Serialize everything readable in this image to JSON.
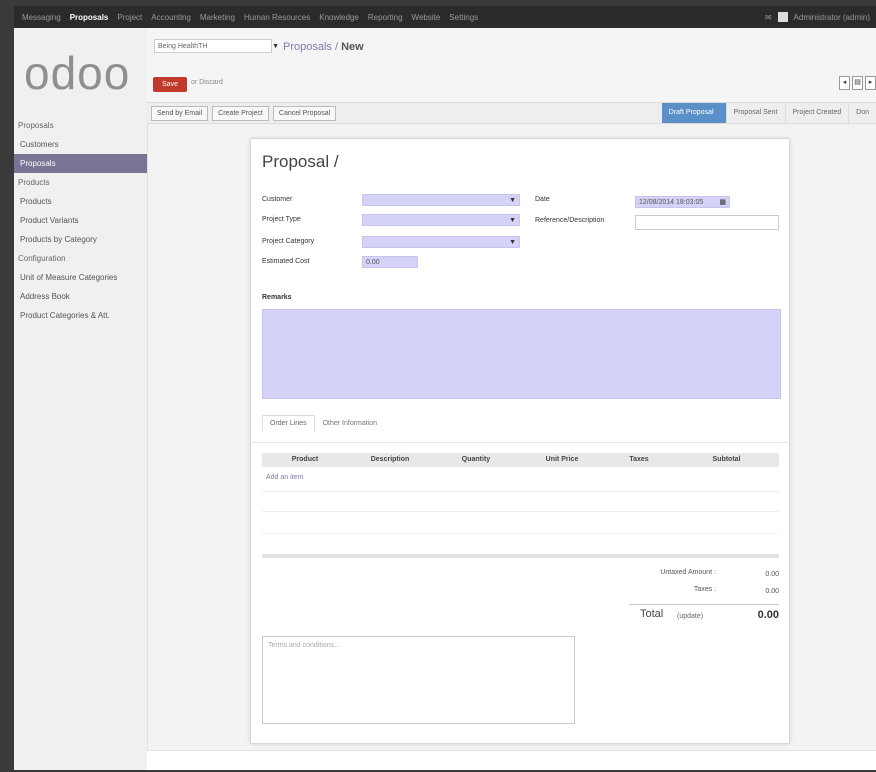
{
  "topbar": {
    "menu": [
      "Messaging",
      "Proposals",
      "Project",
      "Accounting",
      "Marketing",
      "Human Resources",
      "Knowledge",
      "Reporting",
      "Website",
      "Settings"
    ],
    "active_index": 1,
    "user": "Administrator (admin)"
  },
  "sidebar": {
    "logo": "odoo",
    "items": [
      {
        "label": "Proposals",
        "kind": "hdr"
      },
      {
        "label": "Customers",
        "kind": "sub"
      },
      {
        "label": "Proposals",
        "kind": "sub",
        "active": true
      },
      {
        "label": "Products",
        "kind": "hdr"
      },
      {
        "label": "Products",
        "kind": "sub"
      },
      {
        "label": "Product Variants",
        "kind": "sub"
      },
      {
        "label": "Products by Category",
        "kind": "sub"
      },
      {
        "label": "Configuration",
        "kind": "hdr"
      },
      {
        "label": "Unit of Measure Categories",
        "kind": "sub"
      },
      {
        "label": "Address Book",
        "kind": "sub"
      },
      {
        "label": "Product Categories & Att.",
        "kind": "sub"
      }
    ]
  },
  "header": {
    "db": "Being HealthTH",
    "breadcrumb_parent": "Proposals",
    "breadcrumb_sep": " / ",
    "breadcrumb_current": "New",
    "save_label": "Save",
    "discard_label": "or Discard"
  },
  "actions": {
    "buttons": [
      "Send by Email",
      "Create Project",
      "Cancel Proposal"
    ]
  },
  "status": {
    "steps": [
      "Draft Proposal",
      "Proposal Sent",
      "Project Created",
      "Don"
    ],
    "current_index": 0
  },
  "form": {
    "title": "Proposal /",
    "customer_label": "Customer",
    "project_type_label": "Project Type",
    "project_category_label": "Project Category",
    "estimated_cost_label": "Estimated Cost",
    "estimated_cost_value": "0.00",
    "date_label": "Date",
    "date_value": "12/08/2014 18:03:05",
    "reference_label": "Reference/Description",
    "remarks_label": "Remarks"
  },
  "tabs": [
    "Order Lines",
    "Other Information"
  ],
  "lines": {
    "columns": [
      "Product",
      "Description",
      "Quantity",
      "Unit Price",
      "Taxes",
      "Subtotal"
    ],
    "add_item": "Add an item"
  },
  "totals": {
    "untaxed_label": "Untaxed Amount :",
    "untaxed_value": "0.00",
    "taxes_label": "Taxes :",
    "taxes_value": "0.00",
    "total_label": "Total",
    "update_label": "(update)",
    "total_value": "0.00"
  },
  "terms": {
    "placeholder": "Terms and conditions..."
  }
}
